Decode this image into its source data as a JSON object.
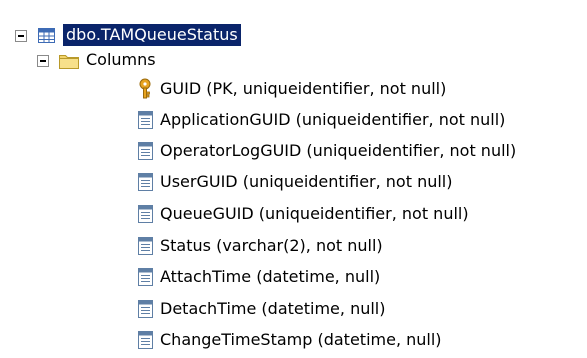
{
  "tree": {
    "table": {
      "label": "dbo.TAMQueueStatus",
      "icon": "table-icon"
    },
    "columns_folder": {
      "label": "Columns",
      "icon": "folder-icon"
    },
    "columns": [
      {
        "label": "GUID (PK, uniqueidentifier, not null)",
        "icon": "primary-key-icon"
      },
      {
        "label": "ApplicationGUID (uniqueidentifier, not null)",
        "icon": "column-icon"
      },
      {
        "label": "OperatorLogGUID (uniqueidentifier, not null)",
        "icon": "column-icon"
      },
      {
        "label": "UserGUID (uniqueidentifier, not null)",
        "icon": "column-icon"
      },
      {
        "label": "QueueGUID (uniqueidentifier, not null)",
        "icon": "column-icon"
      },
      {
        "label": "Status (varchar(2), not null)",
        "icon": "column-icon"
      },
      {
        "label": "AttachTime (datetime, null)",
        "icon": "column-icon"
      },
      {
        "label": "DetachTime (datetime, null)",
        "icon": "column-icon"
      },
      {
        "label": "ChangeTimeStamp (datetime, null)",
        "icon": "column-icon"
      }
    ]
  },
  "colors": {
    "selection_background": "#0a246a",
    "selection_text": "#ffffff",
    "folder": "#f2d36b",
    "key": "#e7a31f"
  }
}
